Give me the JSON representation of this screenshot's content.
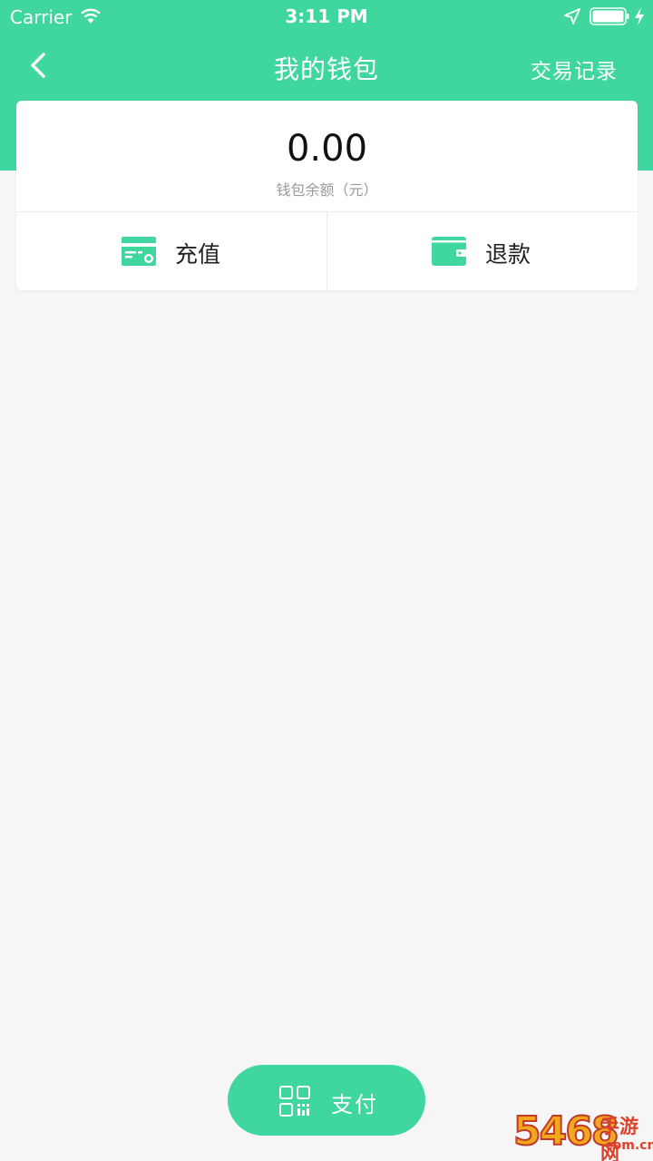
{
  "status_bar": {
    "carrier": "Carrier",
    "time": "3:11 PM"
  },
  "nav": {
    "title": "我的钱包",
    "right_link": "交易记录",
    "back_icon": "chevron-left-icon"
  },
  "wallet": {
    "balance": "0.00",
    "balance_label": "钱包余额（元）",
    "actions": [
      {
        "label": "充值",
        "icon": "card-icon"
      },
      {
        "label": "退款",
        "icon": "wallet-icon"
      }
    ]
  },
  "pay_button": {
    "label": "支付",
    "icon": "qr-code-icon"
  },
  "watermark": {
    "brand_digits": "5468",
    "brand_cn": "手游网",
    "domain": ".com.cn"
  },
  "colors": {
    "accent": "#3fd69f",
    "background": "#f6f6f7"
  }
}
